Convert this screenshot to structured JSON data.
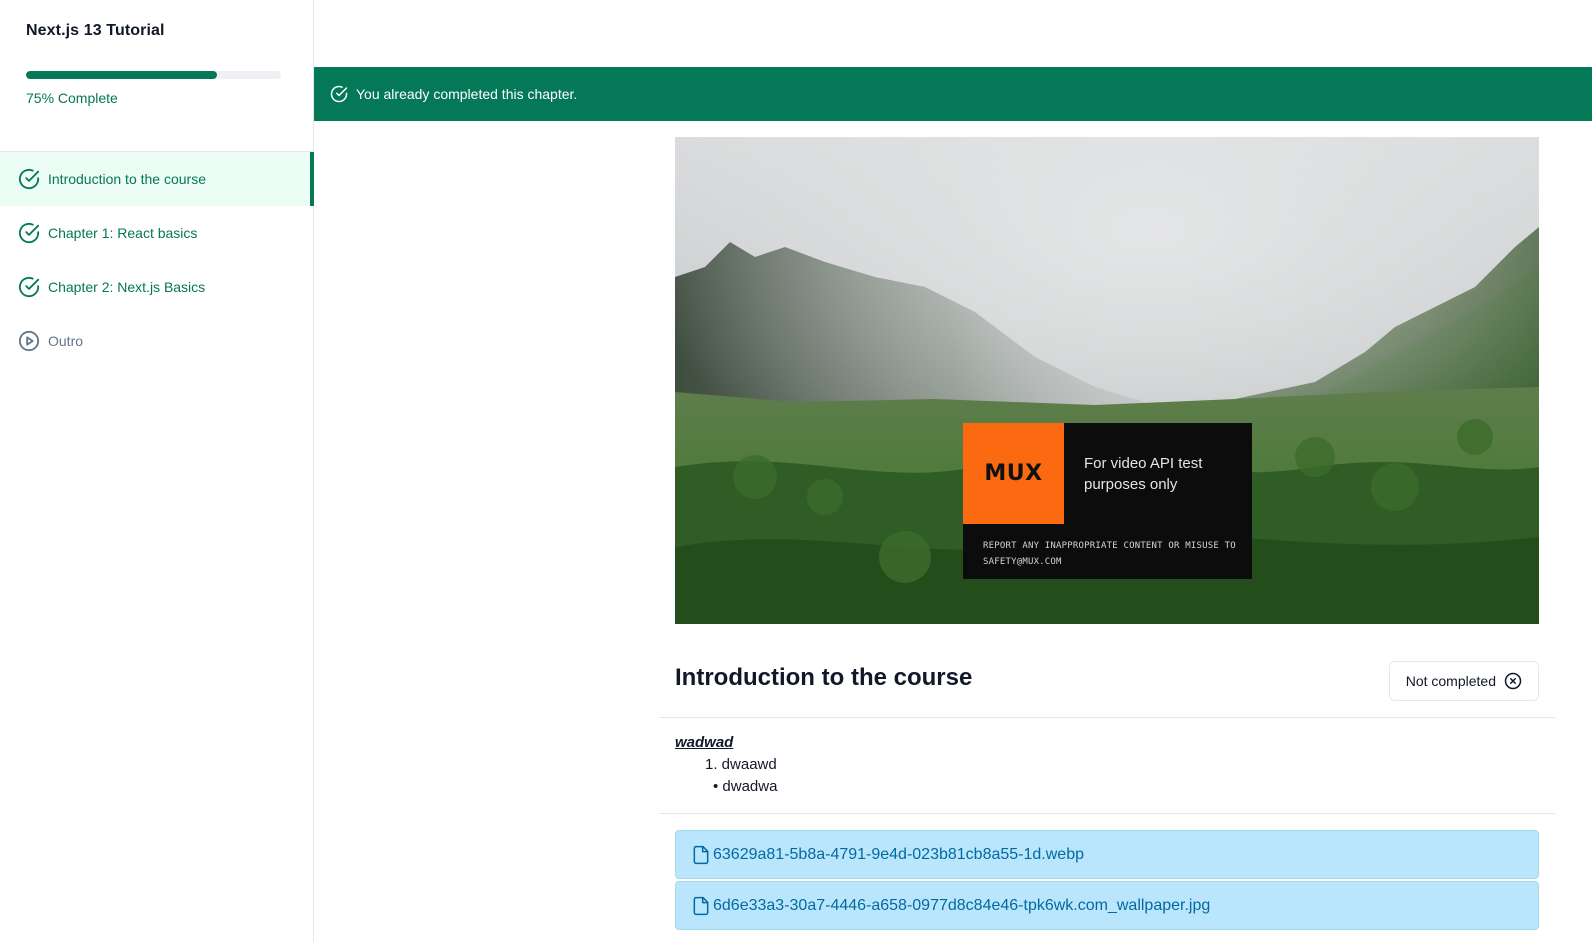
{
  "sidebar": {
    "course_title": "Next.js 13 Tutorial",
    "progress_percent": 75,
    "progress_label": "75% Complete",
    "chapters": [
      {
        "label": "Introduction to the course",
        "status": "completed",
        "active": true,
        "icon": "check-circle-icon"
      },
      {
        "label": "Chapter 1: React basics",
        "status": "completed",
        "active": false,
        "icon": "check-circle-icon"
      },
      {
        "label": "Chapter 2: Next.js Basics",
        "status": "completed",
        "active": false,
        "icon": "check-circle-icon"
      },
      {
        "label": "Outro",
        "status": "not-completed",
        "active": false,
        "icon": "play-circle-icon"
      }
    ]
  },
  "banner": {
    "text": "You already completed this chapter.",
    "icon": "check-circle-icon"
  },
  "video": {
    "overlay_logo": "MUX",
    "overlay_tagline": "For video API test purposes only",
    "overlay_notice": "REPORT ANY INAPPROPRIATE CONTENT OR MISUSE TO SAFETY@MUX.COM"
  },
  "lesson": {
    "title": "Introduction to the course",
    "status_button_label": "Not completed",
    "status_button_icon": "x-circle-icon"
  },
  "description": {
    "heading": "wadwad",
    "ordered_item": "1. dwaawd",
    "bullet_item": "• dwadwa"
  },
  "attachments": [
    {
      "name": "63629a81-5b8a-4791-9e4d-023b81cb8a55-1d.webp",
      "icon": "file-icon"
    },
    {
      "name": "6d6e33a3-30a7-4446-a658-0977d8c84e46-tpk6wk.com_wallpaper.jpg",
      "icon": "file-icon"
    }
  ],
  "colors": {
    "accent": "#047857",
    "active_bg": "#ecfdf5",
    "attachment_bg": "#bae6fd",
    "attachment_text": "#0369a1",
    "mux_orange": "#fb6a10"
  }
}
